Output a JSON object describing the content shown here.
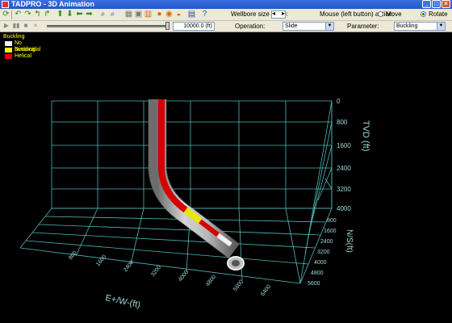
{
  "window": {
    "title": "TADPRO - 3D Animation",
    "controls": [
      "_",
      "□",
      "×"
    ]
  },
  "toolbar": {
    "wellbore_size_label": "Wellbore size scale:",
    "mouse_action_label": "Mouse (left button) action:",
    "move_label": "Move",
    "rotate_label": "Rotate",
    "selected_mode": "Rotate"
  },
  "playback": {
    "controls": [
      "▶",
      "▮▮",
      "■",
      "×"
    ],
    "distance_value": "10000.0 (ft)",
    "operation_label": "Operation:",
    "operation_value": "Slide",
    "parameter_label": "Parameter:",
    "parameter_value": "Buckling"
  },
  "legend": {
    "title": "Buckling",
    "items": [
      {
        "label": "No buckling",
        "color": "#f2f2f2"
      },
      {
        "label": "Sinusoidal",
        "color": "#ffff00"
      },
      {
        "label": "Helical",
        "color": "#e00000"
      }
    ]
  },
  "plot": {
    "grid_color": "#4fb8b8",
    "tvd_axis_label": "TVD (ft)",
    "tvd_ticks": [
      "0",
      "800",
      "1600",
      "2400",
      "3200",
      "4000"
    ],
    "ns_axis_label": "N/S(ft)",
    "ns_ticks": [
      "800",
      "1600",
      "2400",
      "3200",
      "4000",
      "4800",
      "5600"
    ],
    "ew_axis_label": "E+/W-(ft)",
    "ew_ticks": [
      "800",
      "1600",
      "2400",
      "3200",
      "4000",
      "4800",
      "5600",
      "6400"
    ]
  }
}
